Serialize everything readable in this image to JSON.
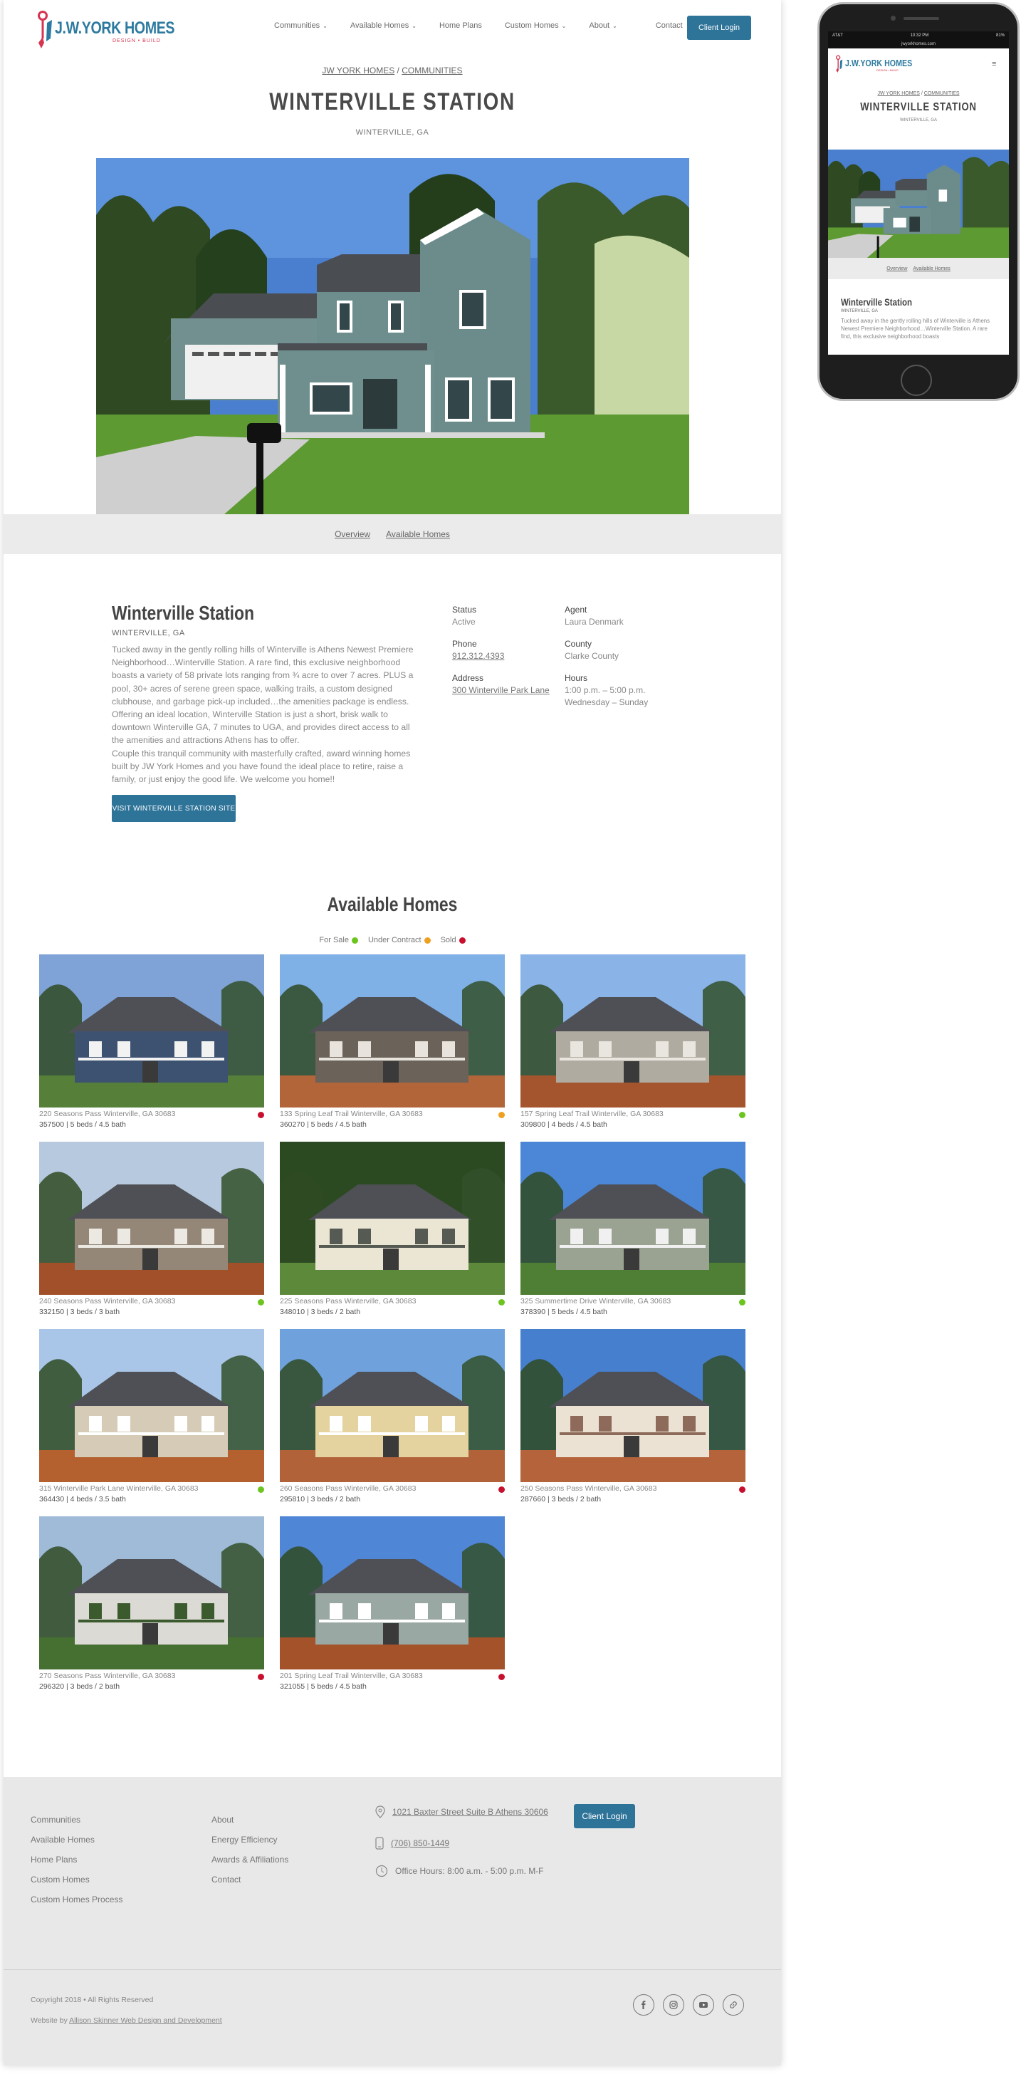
{
  "brand": {
    "logo_text": "J.W.YORK HOMES",
    "logo_sub": "DESIGN • BUILD"
  },
  "nav": {
    "items": [
      {
        "label": "Communities",
        "dropdown": true
      },
      {
        "label": "Available Homes",
        "dropdown": true
      },
      {
        "label": "Home Plans",
        "dropdown": false
      },
      {
        "label": "Custom Homes",
        "dropdown": true
      },
      {
        "label": "About",
        "dropdown": true
      },
      {
        "label": "Contact",
        "dropdown": false
      }
    ],
    "client_login": "Client Login"
  },
  "breadcrumb": {
    "home": "JW YORK HOMES",
    "sep": "/",
    "section": "COMMUNITIES"
  },
  "page": {
    "title": "WINTERVILLE STATION",
    "location": "WINTERVILLE, GA"
  },
  "subnav": {
    "overview": "Overview",
    "available": "Available Homes"
  },
  "info": {
    "title": "Winterville Station",
    "location": "WINTERVILLE, GA",
    "description": "Tucked away in the gently rolling hills of Winterville is Athens Newest Premiere Neighborhood…Winterville Station. A rare find, this exclusive neighborhood boasts a variety of 58 private lots ranging from ¾ acre to over 7 acres. PLUS a pool, 30+ acres of serene green space, walking trails, a custom designed clubhouse, and garbage pick-up included…the amenities package is endless. Offering an ideal location, Winterville Station is just a short, brisk walk to downtown Winterville GA, 7 minutes to UGA, and provides direct access to all the amenities and attractions Athens has to offer.",
    "description2": "Couple this tranquil community with masterfully crafted, award winning homes built by JW York Homes and you have found the ideal place to retire, raise a family, or just enjoy the good life. We welcome you home!!",
    "visit_button": "VISIT WINTERVILLE STATION SITE",
    "status_label": "Status",
    "status_value": "Active",
    "agent_label": "Agent",
    "agent_value": "Laura Denmark",
    "phone_label": "Phone",
    "phone_value": "912.312.4393",
    "county_label": "County",
    "county_value": "Clarke County",
    "address_label": "Address",
    "address_value": "300 Winterville Park Lane",
    "hours_label": "Hours",
    "hours_value": "1:00 p.m. – 5:00 p.m.",
    "hours_days": "Wednesday – Sunday"
  },
  "available": {
    "title": "Available Homes",
    "legend": [
      {
        "label": "For Sale",
        "color": "#6cc51f"
      },
      {
        "label": "Under Contract",
        "color": "#f0a020"
      },
      {
        "label": "Sold",
        "color": "#c8102e"
      }
    ],
    "homes": [
      {
        "address": "220 Seasons Pass Winterville, GA 30683",
        "specs": "357500 | 5 beds / 4.5 bath",
        "status_color": "#c8102e"
      },
      {
        "address": "133 Spring Leaf Trail Winterville, GA 30683",
        "specs": "360270 | 5 beds / 4.5 bath",
        "status_color": "#f0a020"
      },
      {
        "address": "157 Spring Leaf Trail Winterville, GA 30683",
        "specs": "309800 | 4 beds / 4.5 bath",
        "status_color": "#6cc51f"
      },
      {
        "address": "240 Seasons Pass Winterville, GA 30683",
        "specs": "332150 | 3 beds / 3 bath",
        "status_color": "#6cc51f"
      },
      {
        "address": "225 Seasons Pass Winterville, GA 30683",
        "specs": "348010 | 3 beds / 2 bath",
        "status_color": "#6cc51f"
      },
      {
        "address": "325 Summertime Drive Winterville, GA 30683",
        "specs": "378390 | 5 beds / 4.5 bath",
        "status_color": "#6cc51f"
      },
      {
        "address": "315 Winterville Park Lane Winterville, GA 30683",
        "specs": "364430 | 4 beds / 3.5 bath",
        "status_color": "#6cc51f"
      },
      {
        "address": "260 Seasons Pass Winterville, GA 30683",
        "specs": "295810 | 3 beds / 2 bath",
        "status_color": "#c8102e"
      },
      {
        "address": "250 Seasons Pass Winterville, GA 30683",
        "specs": "287660 | 3 beds / 2 bath",
        "status_color": "#c8102e"
      },
      {
        "address": "270 Seasons Pass Winterville, GA 30683",
        "specs": "296320 | 3 beds / 2 bath",
        "status_color": "#c8102e"
      },
      {
        "address": "201 Spring Leaf Trail Winterville, GA 30683",
        "specs": "321055 | 5 beds / 4.5 bath",
        "status_color": "#c8102e"
      }
    ]
  },
  "footer": {
    "col1": [
      "Communities",
      "Available Homes",
      "Home Plans",
      "Custom Homes",
      "Custom Homes Process"
    ],
    "col2": [
      "About",
      "Energy Efficiency",
      "Awards & Affiliations",
      "Contact"
    ],
    "address": "1021 Baxter Street Suite B Athens 30606",
    "phone": "(706) 850-1449",
    "hours": "Office Hours: 8:00 a.m. - 5:00 p.m. M-F",
    "client_login": "Client Login",
    "copyright": "Copyright 2018 • All Rights Reserved",
    "credit_prefix": "Website by",
    "credit_link": "Allison Skinner Web Design and Development",
    "social_icons": [
      "facebook-icon",
      "instagram-icon",
      "youtube-icon",
      "link-icon"
    ]
  },
  "phone_mockup": {
    "carrier": "AT&T",
    "time": "10:32 PM",
    "battery": "81%",
    "url": "jwyorkhomes.com",
    "description": "Tucked away in the gently rolling hills of Winterville is Athens Newest Premiere Neighborhood…Winterville Station. A rare find, this exclusive neighborhood boasts"
  },
  "colors": {
    "accent": "#2e7398",
    "brand_red": "#d6344f",
    "footer_bg": "#e8e8e8"
  }
}
